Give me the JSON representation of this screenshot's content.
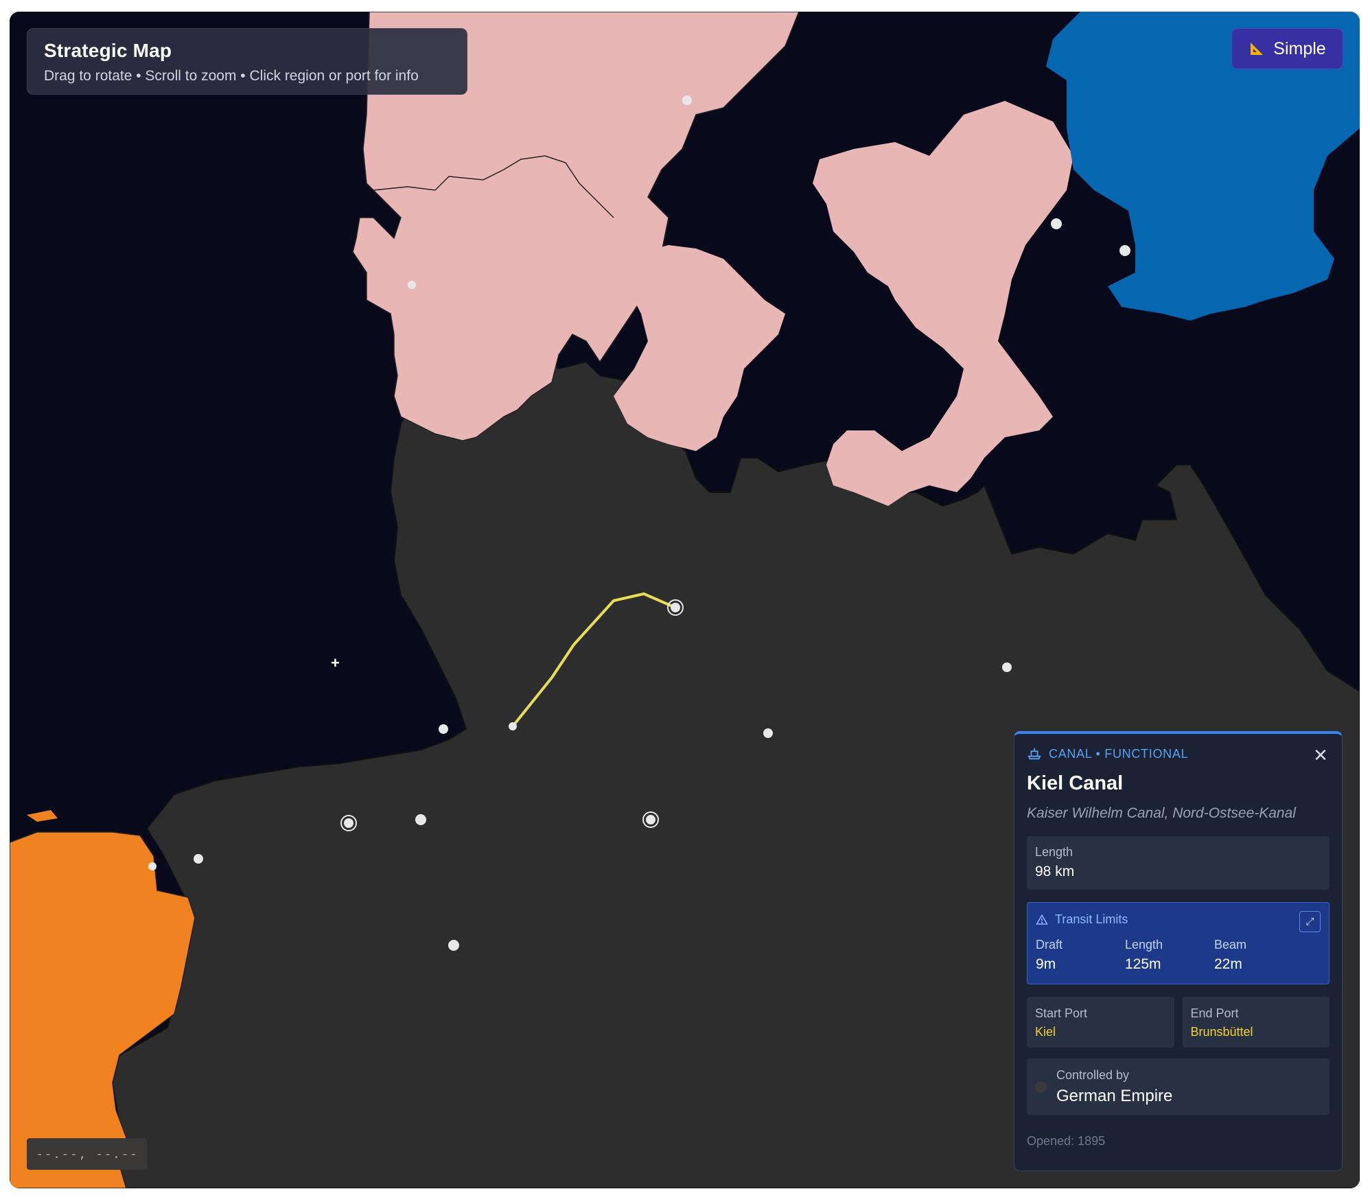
{
  "header": {
    "title": "Strategic Map",
    "subtitle": "Drag to rotate • Scroll to zoom • Click region or port for info"
  },
  "mode_button": {
    "label": "Simple",
    "icon": "ruler-triangle-icon"
  },
  "coordinates": {
    "readout": "--.--, --.--"
  },
  "map": {
    "colors": {
      "sea": "#080a1c",
      "german_empire": "#2d2d2d",
      "denmark": "#e8b6b5",
      "sweden": "#0467b0",
      "netherlands": "#f0831f",
      "canal": "#e8dd55",
      "port": "#e8e8e8"
    },
    "regions": [
      "German Empire",
      "Denmark",
      "Sweden",
      "Netherlands"
    ],
    "selected_route": {
      "name": "Kiel Canal",
      "start": "Kiel",
      "end": "Brunsbüttel"
    }
  },
  "panel": {
    "type_icon": "ship-icon",
    "type_label": "CANAL • FUNCTIONAL",
    "title": "Kiel Canal",
    "alt_names": "Kaiser Wilhelm Canal, Nord-Ostsee-Kanal",
    "length": {
      "label": "Length",
      "value": "98 km"
    },
    "transit": {
      "icon": "warning-triangle-icon",
      "title": "Transit Limits",
      "expand_icon": "expand-arrows-icon",
      "limits": [
        {
          "label": "Draft",
          "value": "9m"
        },
        {
          "label": "Length",
          "value": "125m"
        },
        {
          "label": "Beam",
          "value": "22m"
        }
      ]
    },
    "start_port": {
      "label": "Start Port",
      "value": "Kiel"
    },
    "end_port": {
      "label": "End Port",
      "value": "Brunsbüttel"
    },
    "control": {
      "label": "Controlled by",
      "value": "German Empire",
      "color": "#3a3a3a"
    },
    "opened": "Opened: 1895",
    "close_icon": "close-icon"
  }
}
